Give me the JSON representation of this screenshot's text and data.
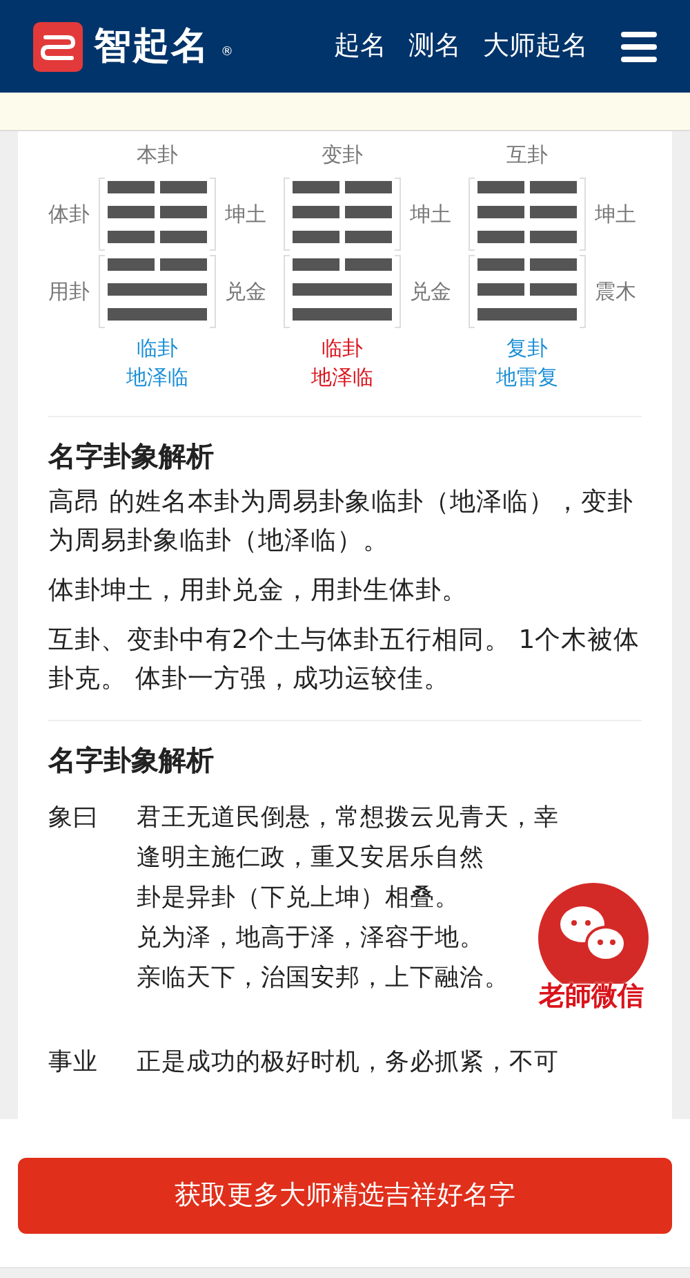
{
  "header": {
    "logo": "智起名",
    "registered": "®",
    "nav": [
      "起名",
      "测名",
      "大师起名"
    ]
  },
  "hexagrams": {
    "left_labels": [
      "体卦",
      "用卦"
    ],
    "items": [
      {
        "title": "本卦",
        "upper": [
          {
            "broken": true
          },
          {
            "broken": true
          },
          {
            "broken": true
          }
        ],
        "lower": [
          {
            "broken": true
          },
          {
            "broken": false
          },
          {
            "broken": false
          }
        ],
        "upper_label": "坤土",
        "lower_label": "兑金",
        "name": "临卦",
        "full_name": "地泽临",
        "color": "#1a8fd6"
      },
      {
        "title": "变卦",
        "upper": [
          {
            "broken": true
          },
          {
            "broken": true
          },
          {
            "broken": true
          }
        ],
        "lower": [
          {
            "broken": true
          },
          {
            "broken": false
          },
          {
            "broken": false
          }
        ],
        "upper_label": "坤土",
        "lower_label": "兑金",
        "name": "临卦",
        "full_name": "地泽临",
        "color": "#d9141c"
      },
      {
        "title": "互卦",
        "upper": [
          {
            "broken": true
          },
          {
            "broken": true
          },
          {
            "broken": true
          }
        ],
        "lower": [
          {
            "broken": true
          },
          {
            "broken": true
          },
          {
            "broken": false
          }
        ],
        "upper_label": "坤土",
        "lower_label": "震木",
        "name": "复卦",
        "full_name": "地雷复",
        "color": "#1a8fd6"
      }
    ]
  },
  "analysis": {
    "heading": "名字卦象解析",
    "paragraphs": [
      "高昂 的姓名本卦为周易卦象临卦（地泽临），变卦为周易卦象临卦（地泽临）。",
      "体卦坤土，用卦兑金，用卦生体卦。",
      "互卦、变卦中有2个土与体卦五行相同。 1个木被体卦克。 体卦一方强，成功运较佳。"
    ]
  },
  "details": {
    "heading": "名字卦象解析",
    "rows": [
      {
        "label": "象曰",
        "lines": [
          "君王无道民倒悬，常想拨云见青天，幸",
          "逢明主施仁政，重又安居乐自然",
          "卦是异卦（下兑上坤）相叠。",
          "兑为泽，地高于泽，泽容于地。",
          "亲临天下，治国安邦，上下融洽。"
        ]
      },
      {
        "label": "事业",
        "lines": [
          "正是成功的极好时机，务必抓紧，不可"
        ]
      }
    ]
  },
  "wechat_badge": {
    "label": "老師微信"
  },
  "cta_button": "获取更多大师精选吉祥好名字"
}
